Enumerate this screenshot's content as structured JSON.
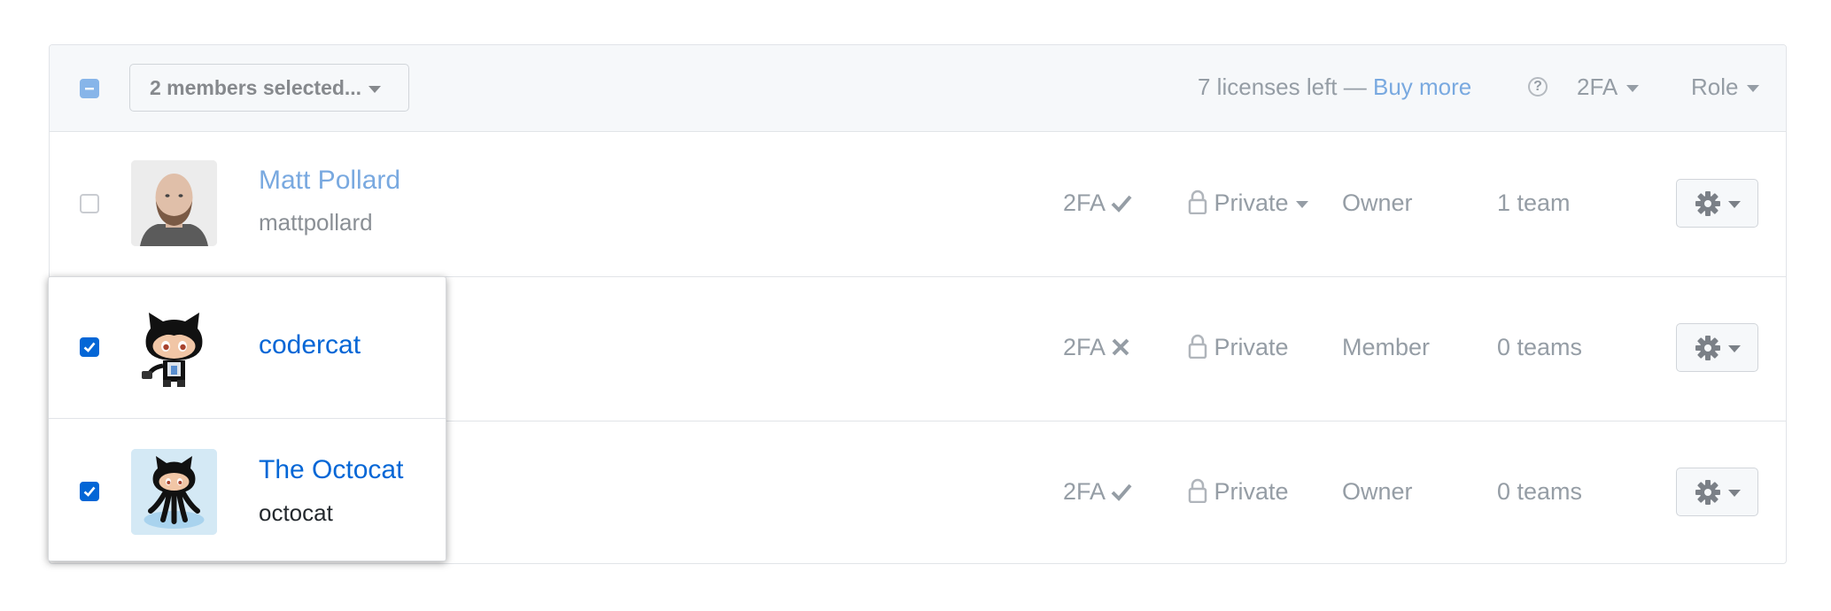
{
  "header": {
    "selection_label": "2 members selected...",
    "licenses_text": "7 licenses left —",
    "buy_more_link": "Buy more",
    "help_glyph": "?",
    "filter_2fa": "2FA",
    "filter_role": "Role"
  },
  "members": [
    {
      "name": "Matt Pollard",
      "login": "mattpollard",
      "two_factor_label": "2FA",
      "two_factor_status": "enabled",
      "visibility": "Private",
      "role": "Owner",
      "teams": "1 team",
      "selected": false
    },
    {
      "name": "codercat",
      "login": "",
      "two_factor_label": "2FA",
      "two_factor_status": "disabled",
      "visibility": "Private",
      "role": "Member",
      "teams": "0 teams",
      "selected": true
    },
    {
      "name": "The Octocat",
      "login": "octocat",
      "two_factor_label": "2FA",
      "two_factor_status": "enabled",
      "visibility": "Private",
      "role": "Owner",
      "teams": "0 teams",
      "selected": true
    }
  ],
  "icons": [
    "check-icon",
    "x-icon",
    "lock-icon",
    "gear-icon",
    "caret-down-icon",
    "question-icon",
    "octocat-avatar"
  ],
  "colors": {
    "accent": "#0366d6",
    "muted_text": "#959da5",
    "faded_link": "#79a9e0",
    "header_bg": "#f6f8fa"
  }
}
